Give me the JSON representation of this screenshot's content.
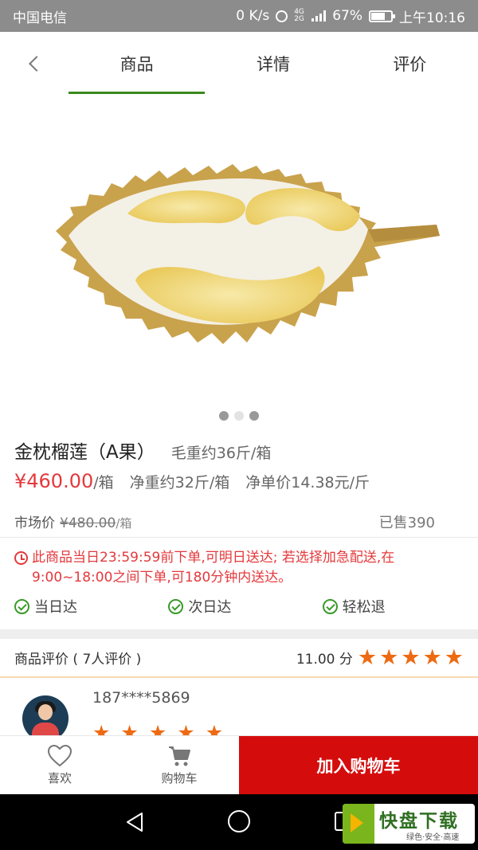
{
  "status_bar": {
    "carrier": "中国电信",
    "speed": "0 K/s",
    "network": "4G 2G",
    "battery": "67%",
    "battery_level": 0.67,
    "time": "上午10:16"
  },
  "top_nav": {
    "tabs": [
      {
        "label": "商品",
        "active": true
      },
      {
        "label": "详情",
        "active": false
      },
      {
        "label": "评价",
        "active": false
      }
    ]
  },
  "gallery": {
    "image_icon": "durian-image",
    "slide_count": 3,
    "active_slide": 1
  },
  "product": {
    "title": "金枕榴莲（A果）",
    "gross_weight": "毛重约36斤/箱",
    "price": "¥460.00",
    "price_unit": "/箱",
    "net_weight": "净重约32斤/箱",
    "unit_price": "净单价14.38元/斤",
    "market_label": "市场价",
    "market_price": "¥480.00",
    "market_unit": "/箱",
    "sold": "已售390"
  },
  "delivery_notice": "此商品当日23:59:59前下单,可明日送达; 若选择加急配送,在9:00~18:00之间下单,可180分钟内送达。",
  "features": [
    "当日达",
    "次日达",
    "轻松退"
  ],
  "reviews": {
    "title": "商品评价 ( 7人评价 )",
    "score": "11.00 分",
    "stars": 5,
    "items": [
      {
        "user": "187****5869",
        "stars": 5
      }
    ]
  },
  "bottom_bar": {
    "favorite": "喜欢",
    "cart": "购物车",
    "add_to_cart": "加入购物车"
  },
  "colors": {
    "price_red": "#e4393c",
    "tab_green": "#3a8a1e",
    "star_orange": "#ee6a12",
    "cta_red": "#d50c0c"
  },
  "watermark": {
    "big": "快盘下载",
    "small": "绿色·安全·高速"
  }
}
